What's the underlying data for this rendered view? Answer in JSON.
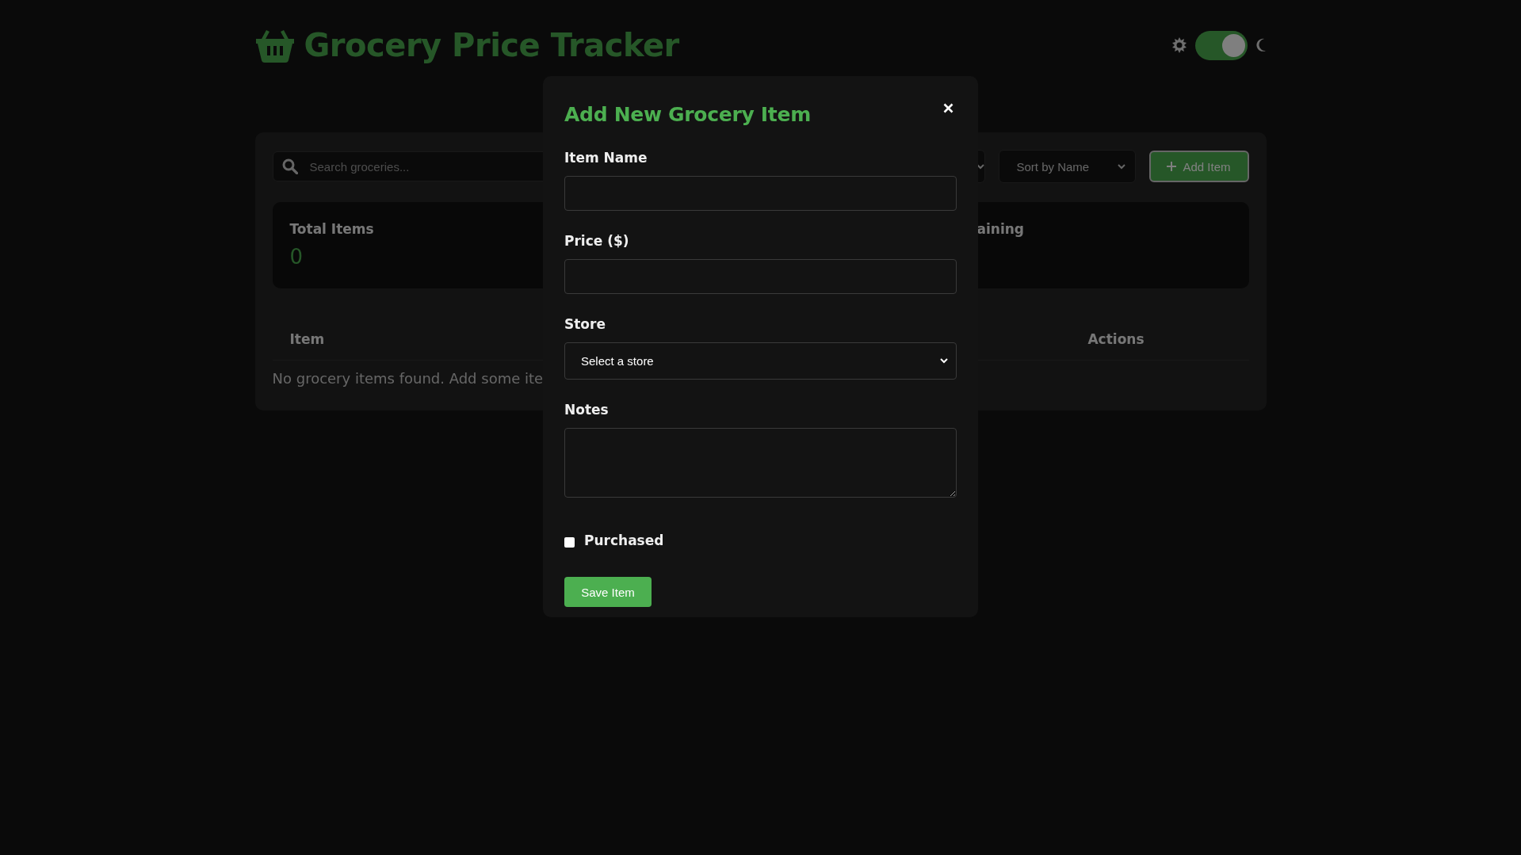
{
  "header": {
    "title": "Grocery Price Tracker",
    "theme_toggle": {
      "on": true
    }
  },
  "toolbar": {
    "search": {
      "placeholder": "Search groceries..."
    },
    "sort_select": {
      "value": "Sort by Name"
    },
    "add_button": "Add Item"
  },
  "stats": [
    {
      "label": "Total Items",
      "value": "0"
    },
    {
      "label": "aining"
    }
  ],
  "table": {
    "columns": [
      "Item",
      "Actions"
    ],
    "empty_message": "No grocery items found. Add some ite"
  },
  "modal": {
    "title": "Add New Grocery Item",
    "fields": [
      {
        "kind": "text",
        "label": "Item Name"
      },
      {
        "kind": "text",
        "label": "Price ($)"
      },
      {
        "kind": "select",
        "label": "Store",
        "value": "Select a store"
      },
      {
        "kind": "textarea",
        "label": "Notes"
      }
    ],
    "purchased": {
      "label": "Purchased",
      "checked": false
    },
    "save_button": "Save Item"
  }
}
